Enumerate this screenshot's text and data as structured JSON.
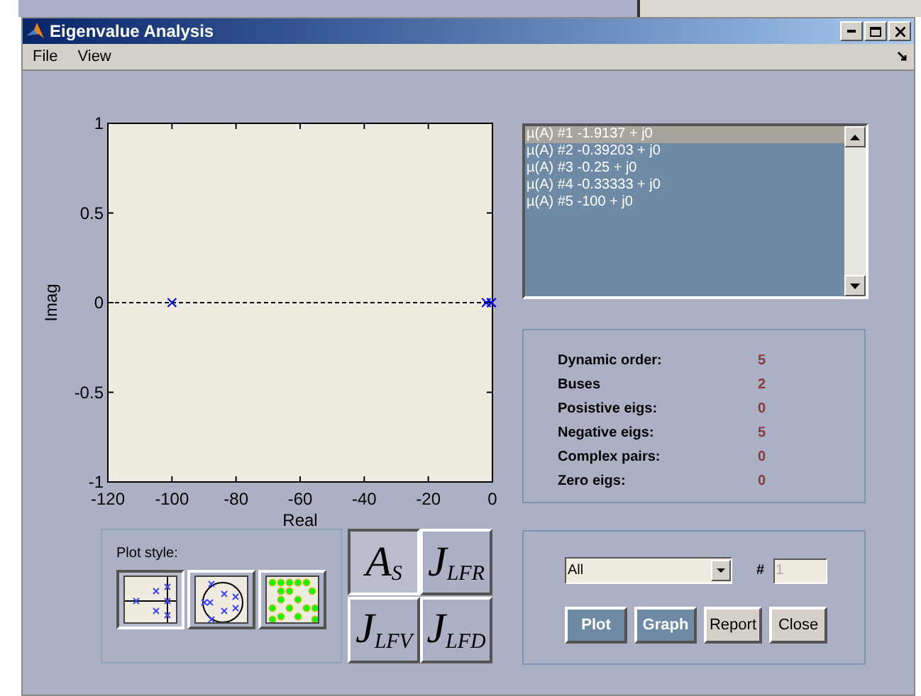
{
  "window": {
    "title": "Eigenvalue Analysis"
  },
  "menu": [
    "File",
    "View"
  ],
  "plot": {
    "chart_data": {
      "type": "scatter",
      "xlabel": "Real",
      "ylabel": "Imag",
      "xlim": [
        -120,
        0
      ],
      "ylim": [
        -1,
        1
      ],
      "xticks": [
        -120,
        -100,
        -80,
        -60,
        -40,
        -20,
        0
      ],
      "yticks": [
        -1,
        -0.5,
        0,
        0.5,
        1
      ],
      "series": [
        {
          "color": "#0000ff",
          "x": [
            -1.9137,
            -0.39203,
            -0.25,
            -0.33333,
            -100
          ],
          "values": [
            0,
            0,
            0,
            0,
            0
          ]
        }
      ]
    }
  },
  "eigenvalue_list": [
    {
      "label": "µ(A) #1 -1.9137 + j0",
      "selected": true
    },
    {
      "label": "µ(A) #2 -0.39203 + j0",
      "selected": false
    },
    {
      "label": "µ(A) #3 -0.25 + j0",
      "selected": false
    },
    {
      "label": "µ(A) #4 -0.33333 + j0",
      "selected": false
    },
    {
      "label": "µ(A) #5 -100 + j0",
      "selected": false
    }
  ],
  "stats": [
    {
      "label": "Dynamic order:",
      "value": "5"
    },
    {
      "label": "Buses",
      "value": "2"
    },
    {
      "label": "Posistive eigs:",
      "value": "0"
    },
    {
      "label": "Negative eigs:",
      "value": "5"
    },
    {
      "label": "Complex pairs:",
      "value": "0"
    },
    {
      "label": "Zero eigs:",
      "value": "0"
    }
  ],
  "plot_style": {
    "label": "Plot style:",
    "options": [
      {
        "kind": "axes",
        "selected": true
      },
      {
        "kind": "circle",
        "selected": false
      },
      {
        "kind": "dots",
        "selected": false
      }
    ]
  },
  "matrix_buttons": [
    {
      "label": "A$_{S}$",
      "selected": true
    },
    {
      "label": "J$_{LFR}$",
      "selected": false
    },
    {
      "label": "J$_{LFV}$",
      "selected": false
    },
    {
      "label": "J$_{LFD}$",
      "selected": false
    }
  ],
  "filter": {
    "value": "All"
  },
  "number": {
    "label": "#",
    "value": "1",
    "disabled": true
  },
  "buttons": [
    {
      "label": "Plot",
      "highlighted": true
    },
    {
      "label": "Graph",
      "highlighted": true
    },
    {
      "label": "Report",
      "highlighted": false
    },
    {
      "label": "Close",
      "highlighted": false
    }
  ]
}
